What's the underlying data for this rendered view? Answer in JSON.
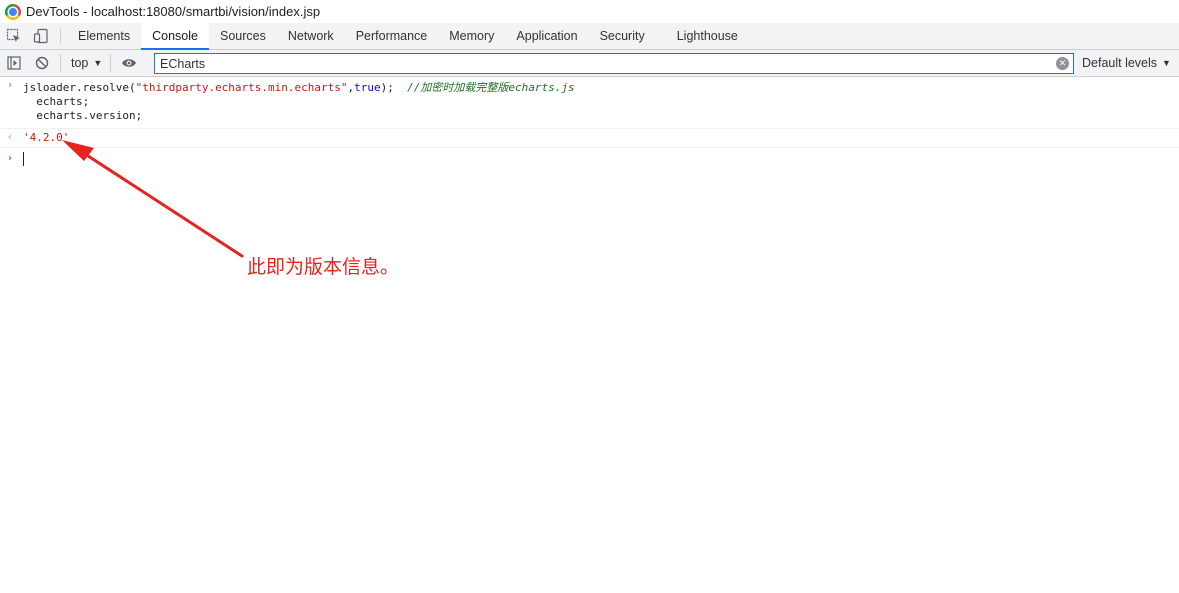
{
  "window": {
    "title": "DevTools - localhost:18080/smartbi/vision/index.jsp"
  },
  "tabs": [
    {
      "label": "Elements",
      "active": false
    },
    {
      "label": "Console",
      "active": true
    },
    {
      "label": "Sources",
      "active": false
    },
    {
      "label": "Network",
      "active": false
    },
    {
      "label": "Performance",
      "active": false
    },
    {
      "label": "Memory",
      "active": false
    },
    {
      "label": "Application",
      "active": false
    },
    {
      "label": "Security",
      "active": false
    },
    {
      "label": "Lighthouse",
      "active": false
    }
  ],
  "toolbar": {
    "context": "top",
    "filter_value": "ECharts",
    "levels_label": "Default levels"
  },
  "console": {
    "input_lines": [
      {
        "code_prefix": "jsloader.resolve(",
        "string": "\"thirdparty.echarts.min.echarts\"",
        "comma": ",",
        "keyword": "true",
        "suffix": ");  ",
        "comment": "//加密时加载完整版echarts.js"
      },
      {
        "code": "  echarts;"
      },
      {
        "code": "  echarts.version;"
      }
    ],
    "result": "'4.2.0'"
  },
  "annotation": {
    "text": "此即为版本信息。",
    "color": "#e8231f"
  },
  "colors": {
    "accent": "#1a73e8",
    "string": "#c41a16",
    "comment": "#236e25",
    "keyword": "#1c00cf"
  }
}
